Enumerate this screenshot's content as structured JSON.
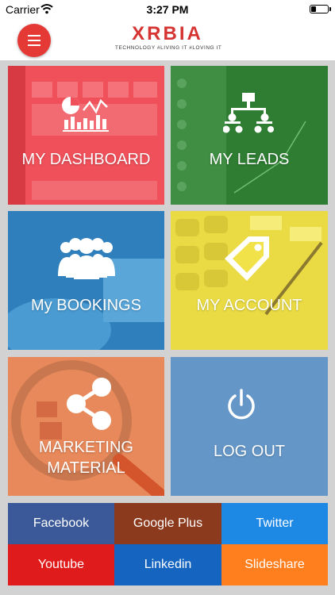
{
  "status_bar": {
    "carrier": "Carrier",
    "time": "3:27 PM",
    "wifi_icon": "wifi-icon",
    "battery_icon": "battery-icon"
  },
  "header": {
    "menu_icon": "hamburger-menu-icon",
    "logo_text": "XRBIA",
    "tagline": "TECHNOLOGY #LIVING IT #LOVING IT",
    "accent_color": "#e53935"
  },
  "tiles": {
    "dashboard": {
      "label": "MY DASHBOARD",
      "icon": "chart-icon",
      "color": "#f0505a"
    },
    "leads": {
      "label": "MY LEADS",
      "icon": "hierarchy-icon",
      "color": "#2e7d32"
    },
    "bookings": {
      "label": "My BOOKINGS",
      "icon": "people-group-icon",
      "color": "#3a8fc8"
    },
    "account": {
      "label": "MY ACCOUNT",
      "icon": "tag-icon",
      "color": "#f2e24a"
    },
    "marketing": {
      "label_line1": "MARKETING",
      "label_line2": "MATERIAL",
      "icon": "share-icon",
      "color": "#e8895b"
    },
    "logout": {
      "label": "LOG OUT",
      "icon": "power-icon",
      "color": "#6497c8"
    }
  },
  "social": {
    "facebook": {
      "label": "Facebook",
      "color": "#3b5998"
    },
    "google_plus": {
      "label": "Google Plus",
      "color": "#8b3a1e"
    },
    "twitter": {
      "label": "Twitter",
      "color": "#1e88e5"
    },
    "youtube": {
      "label": "Youtube",
      "color": "#e01b1b"
    },
    "linkedin": {
      "label": "Linkedin",
      "color": "#1565c0"
    },
    "slideshare": {
      "label": "Slideshare",
      "color": "#ff7f1e"
    }
  }
}
